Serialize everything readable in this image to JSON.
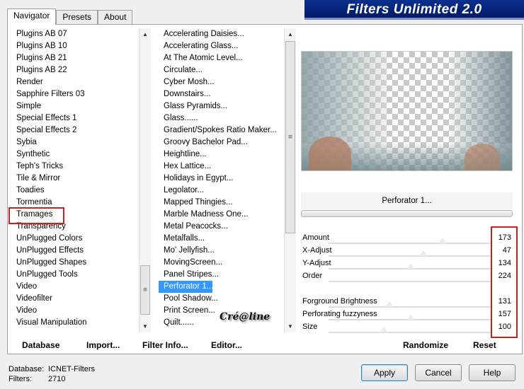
{
  "tabs": [
    "Navigator",
    "Presets",
    "About"
  ],
  "title": "Filters Unlimited 2.0",
  "categories": [
    "Plugins AB 07",
    "Plugins AB 10",
    "Plugins AB 21",
    "Plugins AB 22",
    "Render",
    "Sapphire Filters 03",
    "Simple",
    "Special Effects 1",
    "Special Effects 2",
    "Sybia",
    "Synthetic",
    "Teph's Tricks",
    "Tile & Mirror",
    "Toadies",
    "Tormentia",
    "Tramages",
    "Transparency",
    "UnPlugged Colors",
    "UnPlugged Effects",
    "UnPlugged Shapes",
    "UnPlugged Tools",
    "Video",
    "Videofilter",
    "Video",
    "Visual Manipulation"
  ],
  "filters": [
    "Accelerating Daisies...",
    "Accelerating Glass...",
    "At The Atomic Level...",
    "Circulate...",
    "Cyber Mosh...",
    "Downstairs...",
    "Glass Pyramids...",
    "Glass......",
    "Gradient/Spokes Ratio Maker...",
    "Groovy Bachelor Pad...",
    "Heightline...",
    "Hex Lattice...",
    "Holidays in Egypt...",
    "Legolator...",
    "Mapped Thingies...",
    "Marble Madness One...",
    "Metal Peacocks...",
    "Metalfalls...",
    "Mo' Jellyfish...",
    "MovingScreen...",
    "Panel Stripes...",
    "Perforator 1...",
    "Pool Shadow...",
    "Print Screen...",
    "Quilt......"
  ],
  "selected_filter": "Perforator 1...",
  "params": [
    {
      "label": "Amount",
      "value": "173"
    },
    {
      "label": "X-Adjust",
      "value": "47"
    },
    {
      "label": "Y-Adjust",
      "value": "134"
    },
    {
      "label": "Order",
      "value": "224"
    },
    {
      "label": "",
      "value": ""
    },
    {
      "label": "Forground Brightness",
      "value": "131"
    },
    {
      "label": "Perforating fuzzyness",
      "value": "157"
    },
    {
      "label": "Size",
      "value": "100"
    }
  ],
  "watermark": "Cré@line",
  "bottom_links": {
    "database": "Database",
    "import": "Import...",
    "filter_info": "Filter Info...",
    "editor": "Editor...",
    "randomize": "Randomize",
    "reset": "Reset"
  },
  "status": {
    "database_label": "Database:",
    "database_value": "ICNET-Filters",
    "filters_label": "Filters:",
    "filters_value": "2710"
  },
  "buttons": {
    "apply": "Apply",
    "cancel": "Cancel",
    "help": "Help"
  },
  "colors": {
    "selection": "#3399ff",
    "highlight": "#cc1f1f",
    "banner": "#0a2f8e"
  }
}
